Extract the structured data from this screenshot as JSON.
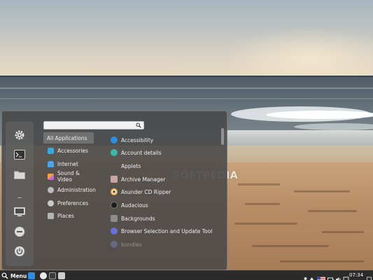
{
  "wallpaper": {
    "watermark": "SOFTPEDIA"
  },
  "menu": {
    "search": {
      "placeholder": "",
      "value": ""
    },
    "favorites": [
      {
        "name": "settings-icon"
      },
      {
        "name": "terminal-icon"
      },
      {
        "name": "folder-icon"
      },
      {
        "name": "display-icon"
      },
      {
        "name": "lock-icon"
      },
      {
        "name": "power-icon"
      }
    ],
    "categories": [
      {
        "label": "All Applications",
        "active": true
      },
      {
        "label": "Accessories",
        "icon": "accessories-icon"
      },
      {
        "label": "Internet",
        "icon": "internet-icon"
      },
      {
        "label": "Sound & Video",
        "icon": "sound-video-icon"
      },
      {
        "label": "Administration",
        "icon": "administration-icon"
      },
      {
        "label": "Preferences",
        "icon": "preferences-icon"
      },
      {
        "label": "Places",
        "icon": "places-icon"
      }
    ],
    "apps": [
      {
        "label": "Accessibility",
        "icon": "accessibility-icon"
      },
      {
        "label": "Account details",
        "icon": "account-icon"
      },
      {
        "label": "Applets"
      },
      {
        "label": "Archive Manager",
        "icon": "archive-icon"
      },
      {
        "label": "Asunder CD Ripper",
        "icon": "cd-icon"
      },
      {
        "label": "Audacious",
        "icon": "audacious-icon"
      },
      {
        "label": "Backgrounds",
        "icon": "backgrounds-icon"
      },
      {
        "label": "Browser Selection and Update Tool",
        "icon": "browser-icon"
      },
      {
        "label": "bundles",
        "icon": "bundles-icon"
      }
    ]
  },
  "taskbar": {
    "menu_label": "Menu",
    "clock": "07:34"
  },
  "colors": {
    "accent_blue": "#2d8fe0",
    "menu_bg": "#484848",
    "taskbar_bg": "#2b2b2b"
  }
}
